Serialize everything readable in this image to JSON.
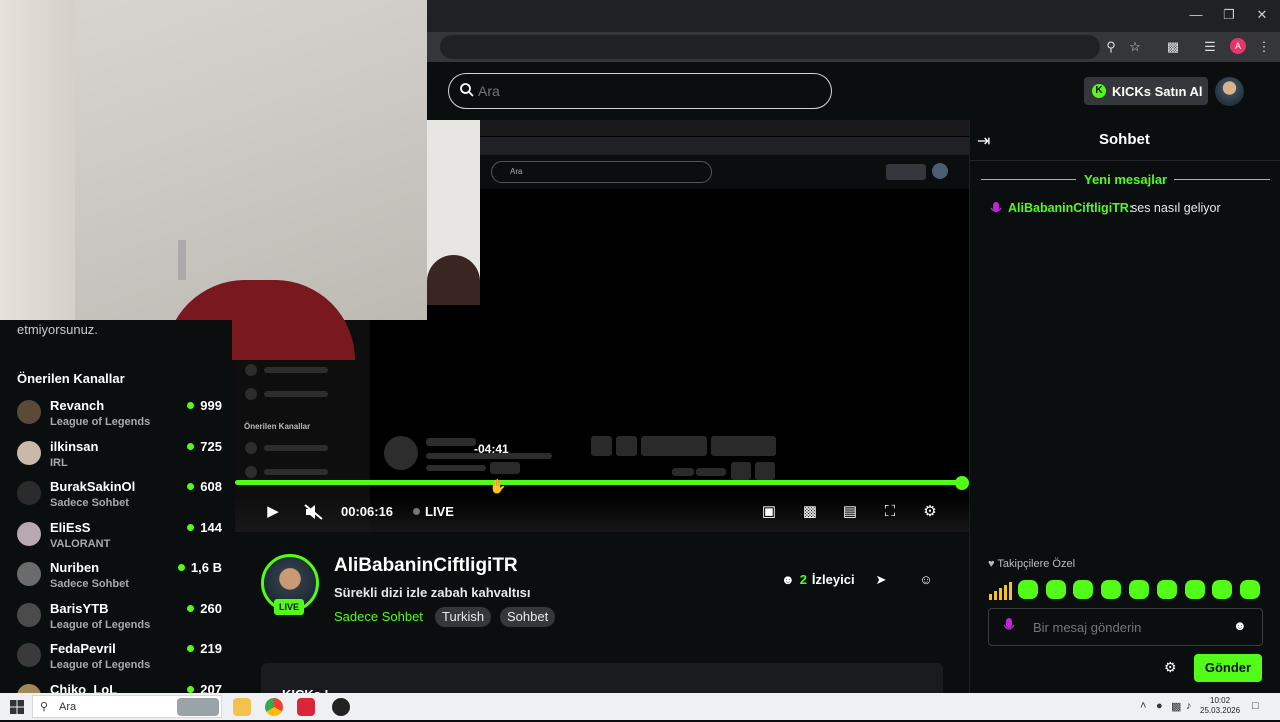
{
  "header": {
    "search_placeholder": "Ara",
    "kicks_button": "KICKs Satın Al"
  },
  "sidebar": {
    "note": "etmiyorsunuz.",
    "heading": "Önerilen Kanallar",
    "channels": [
      {
        "name": "Revanch",
        "category": "League of Legends",
        "viewers": "999"
      },
      {
        "name": "ilkinsan",
        "category": "IRL",
        "viewers": "725"
      },
      {
        "name": "BurakSakinOl",
        "category": "Sadece Sohbet",
        "viewers": "608"
      },
      {
        "name": "EliEsS",
        "category": "VALORANT",
        "viewers": "144"
      },
      {
        "name": "Nuriben",
        "category": "Sadece Sohbet",
        "viewers": "1,6 B"
      },
      {
        "name": "BarisYTB",
        "category": "League of Legends",
        "viewers": "260"
      },
      {
        "name": "FedaPevril",
        "category": "League of Legends",
        "viewers": "219"
      },
      {
        "name": "Chiko_LoL",
        "category": "",
        "viewers": "207"
      }
    ]
  },
  "player": {
    "seek_tooltip": "-04:41",
    "time": "00:06:16",
    "live": "LIVE",
    "progress": 0.99,
    "nested_search": "Ara",
    "nested_heading": "Önerilen Kanallar"
  },
  "channel": {
    "name": "AliBabaninCiftligiTR",
    "live_badge": "LIVE",
    "title": "Sürekli dizi izle zabah kahvaltısı",
    "category": "Sadece Sohbet",
    "tags": [
      "Turkish",
      "Sohbet"
    ],
    "viewer_count": "2",
    "viewer_label": "İzleyici",
    "kicks_panel_title": "KICKs L"
  },
  "chat": {
    "title": "Sohbet",
    "new_messages": "Yeni mesajlar",
    "messages": [
      {
        "user": "AliBabaninCiftligiTR:",
        "text": "ses nasıl geliyor"
      }
    ],
    "followers_only": "Takipçilere Özel",
    "input_placeholder": "Bir mesaj gönderin",
    "send": "Gönder"
  },
  "taskbar": {
    "search": "Ara",
    "time": "10:02",
    "date": "25.03.2026"
  },
  "colors": {
    "accent": "#53fc18",
    "background": "#0b0e0f",
    "pill": "#35383b",
    "mic_icon": "#c026d3"
  }
}
